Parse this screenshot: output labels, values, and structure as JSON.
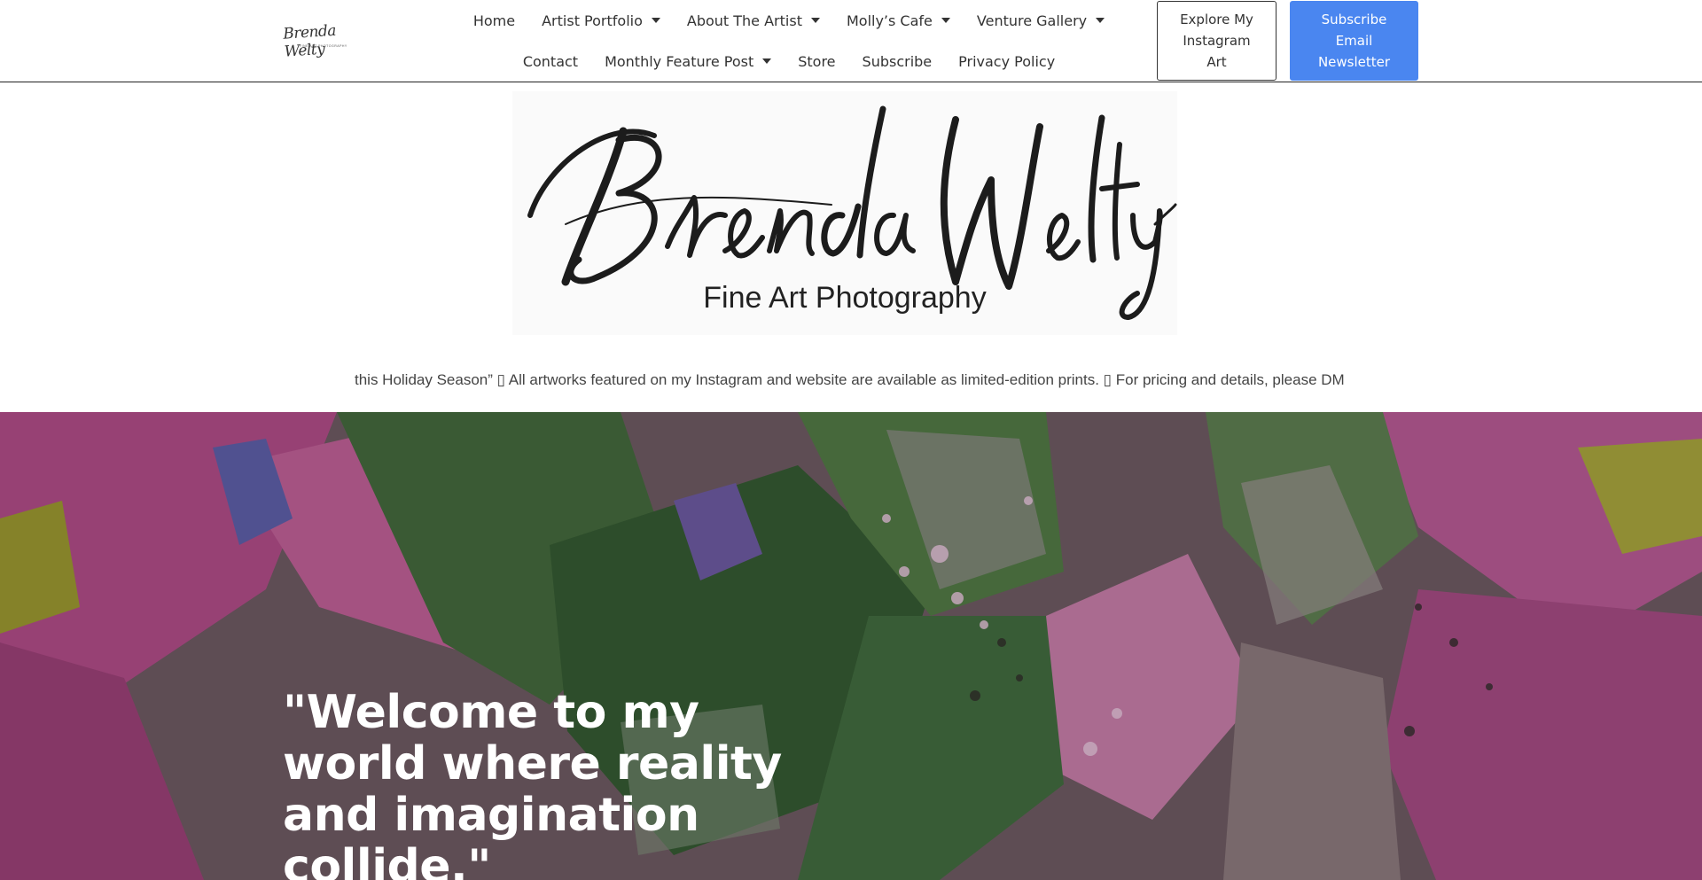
{
  "header": {
    "logo_small_text": "Brenda Welty",
    "logo_small_sub": "FINE ART PHOTOGRAPHY",
    "nav_row1": [
      {
        "label": "Home",
        "dropdown": false
      },
      {
        "label": "Artist Portfolio",
        "dropdown": true
      },
      {
        "label": "About The Artist",
        "dropdown": true
      },
      {
        "label": "Molly’s Cafe",
        "dropdown": true
      },
      {
        "label": "Venture Gallery",
        "dropdown": true
      }
    ],
    "nav_row2": [
      {
        "label": "Contact",
        "dropdown": false
      },
      {
        "label": "Monthly Feature Post",
        "dropdown": true
      },
      {
        "label": "Store",
        "dropdown": false
      },
      {
        "label": "Subscribe",
        "dropdown": false
      },
      {
        "label": "Privacy Policy",
        "dropdown": false
      }
    ],
    "instagram_button": "Explore My Instagram Art",
    "subscribe_button": "Subscribe Email Newsletter"
  },
  "brand": {
    "name": "Brenda Welty",
    "tagline": "Fine Art Photography"
  },
  "marquee": {
    "text": "this Holiday Season” ▯ All artworks featured on my Instagram and website are available as limited-edition prints. ▯ For pricing and details, please DM me or ema"
  },
  "hero": {
    "quote": "\"Welcome to my world where reality and imagination collide.\""
  },
  "colors": {
    "accent_blue": "#4a86f0",
    "hero_magenta": "#a83a78",
    "hero_green": "#3f6a38"
  }
}
